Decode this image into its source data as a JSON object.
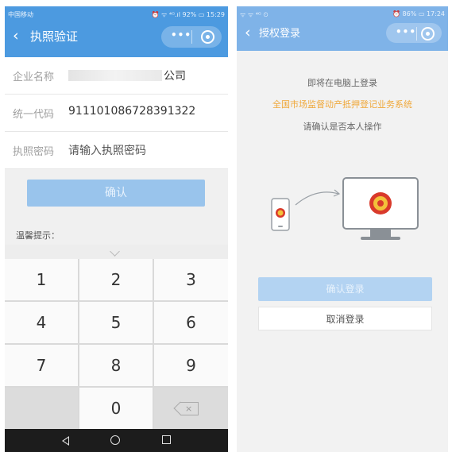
{
  "left": {
    "status": {
      "carrier": "中国移动",
      "indicators": "⏰ ᯤ ⁴ᴳ.ıl 92% ▭ 15:29"
    },
    "nav": {
      "back_icon": "‹",
      "title": "执照验证",
      "more_icon": "•••"
    },
    "form": {
      "company_label": "企业名称",
      "company_suffix": "公司",
      "code_label": "统一代码",
      "code_value": "911101086728391322",
      "pwd_label": "执照密码",
      "pwd_placeholder": "请输入执照密码"
    },
    "confirm_label": "确认",
    "tip": "温馨提示：",
    "keypad": [
      "1",
      "2",
      "3",
      "4",
      "5",
      "6",
      "7",
      "8",
      "9",
      "0"
    ],
    "backspace_label": "×"
  },
  "right": {
    "status": {
      "indicators_left": "ᯤ ᯤ ⁴ᴳ ⏲",
      "indicators_right": "⏰ 86% ▭ 17:24"
    },
    "nav": {
      "back_icon": "‹",
      "title": "授权登录",
      "more_icon": "•••"
    },
    "line1": "即将在电脑上登录",
    "line2": "全国市场监督动产抵押登记业务系统",
    "line3": "请确认是否本人操作",
    "confirm_label": "确认登录",
    "cancel_label": "取消登录"
  },
  "colors": {
    "header": "#4c9ae0",
    "accent_orange": "#f0a83a",
    "button_blue": "#99c4ec"
  }
}
